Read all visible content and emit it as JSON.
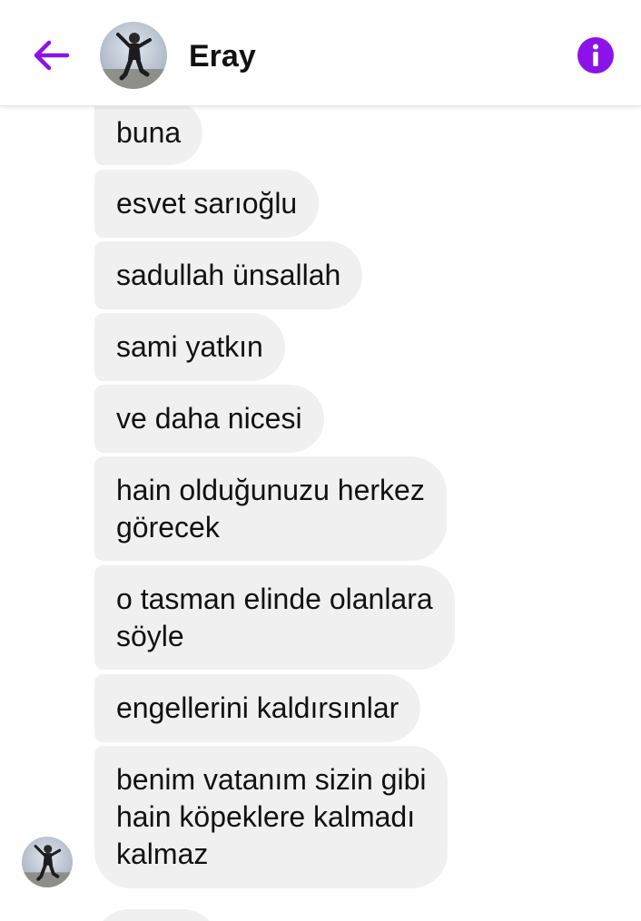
{
  "header": {
    "contact_name": "Eray",
    "back_icon": "arrow-left-icon",
    "info_icon": "info-circle-icon",
    "accent_color": "#8c13e8"
  },
  "colors": {
    "bubble_bg": "#f1f0f0",
    "text": "#111111"
  },
  "messages": [
    {
      "text": "buna"
    },
    {
      "text": "esvet sarıoğlu"
    },
    {
      "text": "sadullah ünsallah"
    },
    {
      "text": "sami yatkın"
    },
    {
      "text": "ve daha nicesi"
    },
    {
      "text": "hain olduğunuzu herkez\ngörecek"
    },
    {
      "text": "o tasman elinde olanlara\nsöyle"
    },
    {
      "text": "engellerini kaldırsınlar"
    },
    {
      "text": "benim vatanım sizin gibi\nhain köpeklere kalmadı\nkalmaz"
    }
  ]
}
